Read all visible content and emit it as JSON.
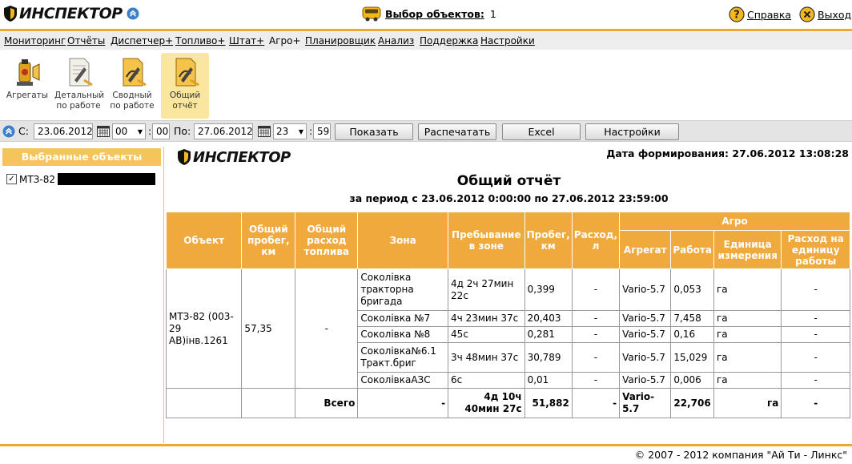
{
  "header": {
    "logo_text": "ИНСПЕКТОР",
    "select_label": "Выбор объектов:",
    "select_count": "1",
    "help_label": "Справка",
    "exit_label": "Выход"
  },
  "menu": [
    {
      "label": "Мониторинг",
      "active": false
    },
    {
      "label": "Отчёты",
      "active": false
    },
    {
      "label": "Диспетчер+",
      "active": false
    },
    {
      "label": "Топливо+",
      "active": false
    },
    {
      "label": "Штат+",
      "active": false
    },
    {
      "label": "Агро+",
      "active": true
    },
    {
      "label": "Планировщик",
      "active": false
    },
    {
      "label": "Анализ",
      "active": false
    },
    {
      "label": "Поддержка",
      "active": false
    },
    {
      "label": "Настройки",
      "active": false
    }
  ],
  "toolbar": [
    {
      "label": "Агрегаты",
      "icon": "aggregates-icon",
      "active": false
    },
    {
      "label": "Детальный\nпо работе",
      "icon": "detail-report-icon",
      "active": false
    },
    {
      "label": "Сводный\nпо работе",
      "icon": "summary-report-icon",
      "active": false
    },
    {
      "label": "Общий\nотчёт",
      "icon": "general-report-icon",
      "active": true
    }
  ],
  "filter": {
    "from_label": "С:",
    "from_date": "23.06.2012",
    "from_hour": "00",
    "from_min": "00",
    "to_label": "По:",
    "to_date": "27.06.2012",
    "to_hour": "23",
    "to_min": "59",
    "show_btn": "Показать",
    "print_btn": "Распечатать",
    "excel_btn": "Excel",
    "settings_btn": "Настройки"
  },
  "left": {
    "header": "Выбранные объекты",
    "item_label": "МТЗ-82",
    "item_checked": true
  },
  "report": {
    "logo_text": "ИНСПЕКТОР",
    "gen_date": "Дата формирования: 27.06.2012 13:08:28",
    "title": "Общий отчёт",
    "subtitle": "за период с 23.06.2012 0:00:00 по 27.06.2012 23:59:00",
    "headers": {
      "object": "Объект",
      "total_mileage": "Общий пробег, км",
      "total_fuel": "Общий расход топлива",
      "zone": "Зона",
      "stay": "Пребывание в зоне",
      "mileage": "Пробег, км",
      "fuel": "Расход, л",
      "agro": "Агро",
      "aggregate": "Агрегат",
      "work": "Работа",
      "unit": "Единица измерения",
      "per_unit": "Расход на единицу работы"
    },
    "object_name": "МТЗ-82 (003-29 АВ)інв.1261",
    "object_mileage": "57,35",
    "object_fuel": "-",
    "rows": [
      {
        "zone": "Соколівка тракторна бригада",
        "stay": "4д 2ч 27мин 22с",
        "mileage": "0,399",
        "fuel": "-",
        "aggregate": "Vario-5.7",
        "work": "0,053",
        "unit": "га",
        "per_unit": "-"
      },
      {
        "zone": "Соколівка №7",
        "stay": "4ч 23мин 37с",
        "mileage": "20,403",
        "fuel": "-",
        "aggregate": "Vario-5.7",
        "work": "7,458",
        "unit": "га",
        "per_unit": "-"
      },
      {
        "zone": "Соколівка №8",
        "stay": "45с",
        "mileage": "0,281",
        "fuel": "-",
        "aggregate": "Vario-5.7",
        "work": "0,16",
        "unit": "га",
        "per_unit": "-"
      },
      {
        "zone": "Соколівка№6.1 Тракт.бриг",
        "stay": "3ч 48мин 37с",
        "mileage": "30,789",
        "fuel": "-",
        "aggregate": "Vario-5.7",
        "work": "15,029",
        "unit": "га",
        "per_unit": "-"
      },
      {
        "zone": "СоколівкаАЗС",
        "stay": "6с",
        "mileage": "0,01",
        "fuel": "-",
        "aggregate": "Vario-5.7",
        "work": "0,006",
        "unit": "га",
        "per_unit": "-"
      }
    ],
    "total": {
      "label": "Всего",
      "zone": "-",
      "stay": "4д 10ч 40мин 27с",
      "mileage": "51,882",
      "fuel": "-",
      "aggregate": "Vario-5.7",
      "work": "22,706",
      "unit": "га",
      "per_unit": "-"
    }
  },
  "footer": {
    "copyright": "© 2007 - 2012 компания \"Ай Ти - Линкс\""
  }
}
